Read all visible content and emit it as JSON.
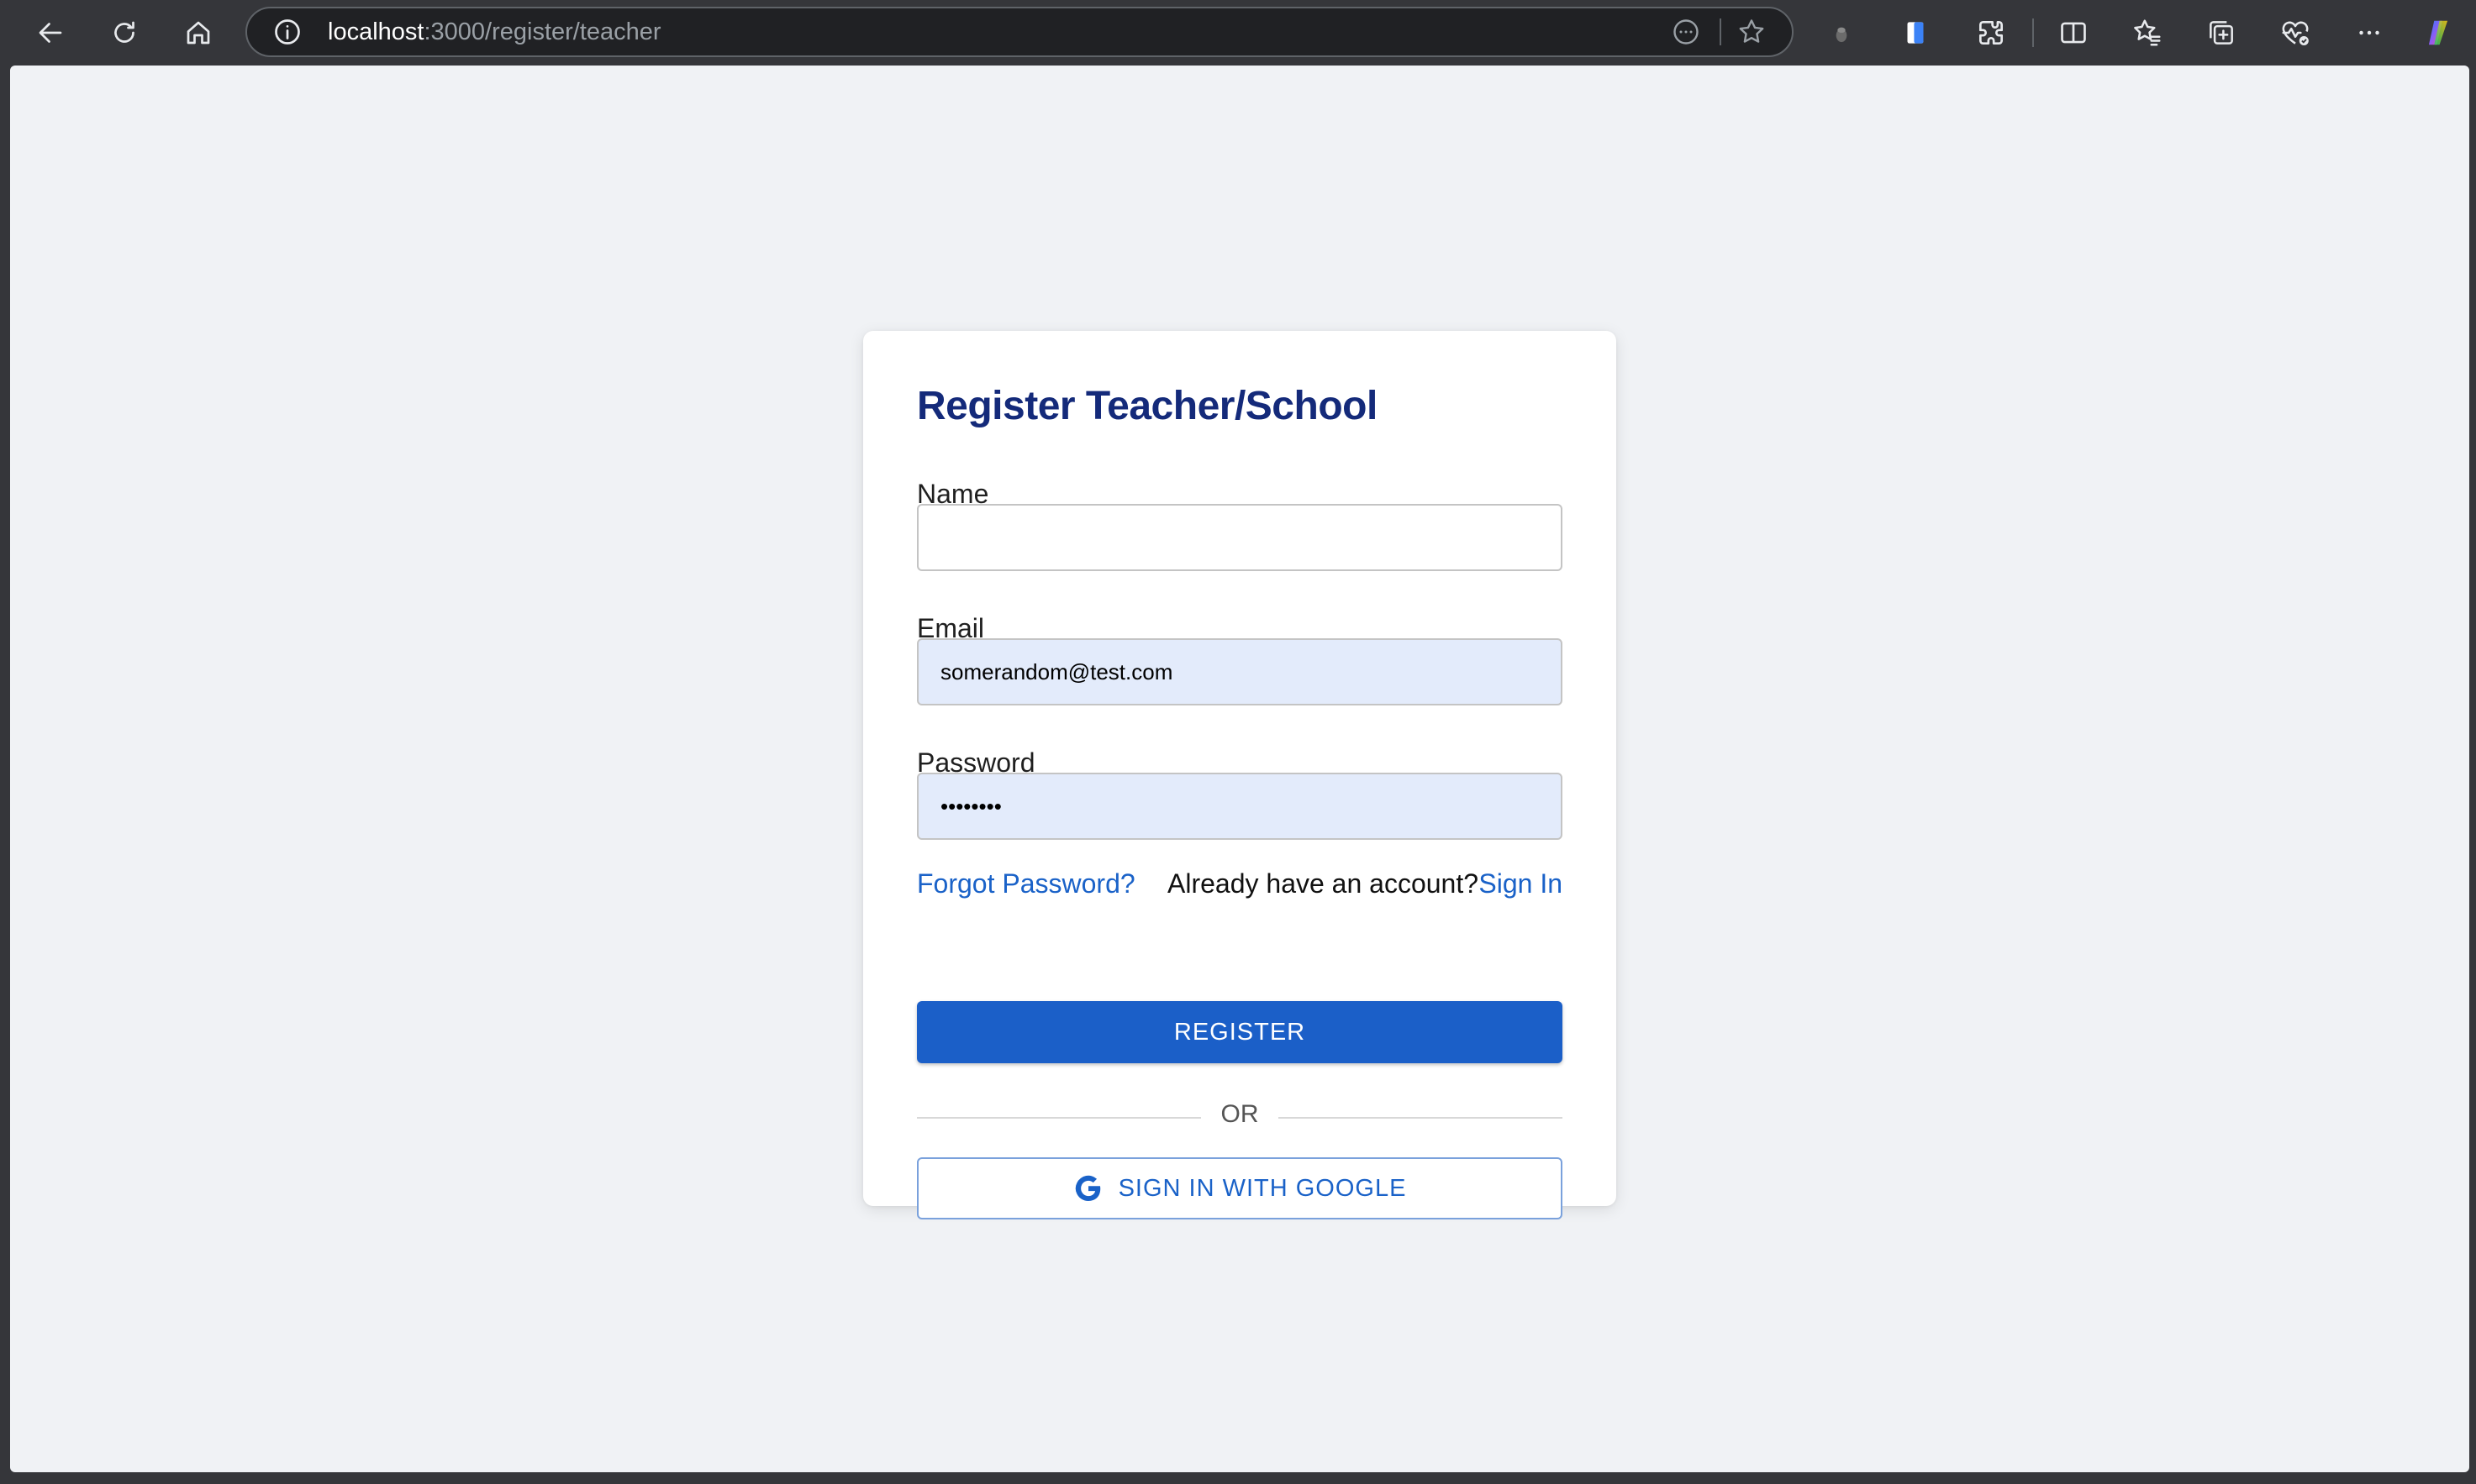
{
  "browser": {
    "url_host": "localhost",
    "url_path": ":3000/register/teacher",
    "icons": {
      "back": "back-arrow-icon",
      "reload": "reload-icon",
      "home": "home-icon",
      "site_info": "info-icon",
      "reader": "reader-mode-icon",
      "favorite": "star-icon",
      "profile": "profile-icon",
      "extension_blue": "extension-icon",
      "extensions": "puzzle-icon",
      "split_screen": "split-screen-icon",
      "favorites": "favorites-icon",
      "collections": "collections-icon",
      "browser_essentials": "heart-pulse-icon",
      "more": "more-icon",
      "copilot": "copilot-icon"
    }
  },
  "card": {
    "title": "Register Teacher/School",
    "name_label": "Name",
    "name_value": "",
    "email_label": "Email",
    "email_value": "somerandom@test.com",
    "password_label": "Password",
    "password_value": "••••••••",
    "forgot_link": "Forgot Password?",
    "account_text": "Already have an account?",
    "signin_link": "Sign In",
    "register_button": "REGISTER",
    "or_text": "OR",
    "google_button": "SIGN IN WITH GOOGLE"
  },
  "colors": {
    "title": "#142a7a",
    "primary": "#1b5fc8",
    "link": "#1a62c8",
    "autofill_bg": "#e3ebfb",
    "page_bg": "#f0f2f5",
    "chrome_bg": "#35363a"
  }
}
